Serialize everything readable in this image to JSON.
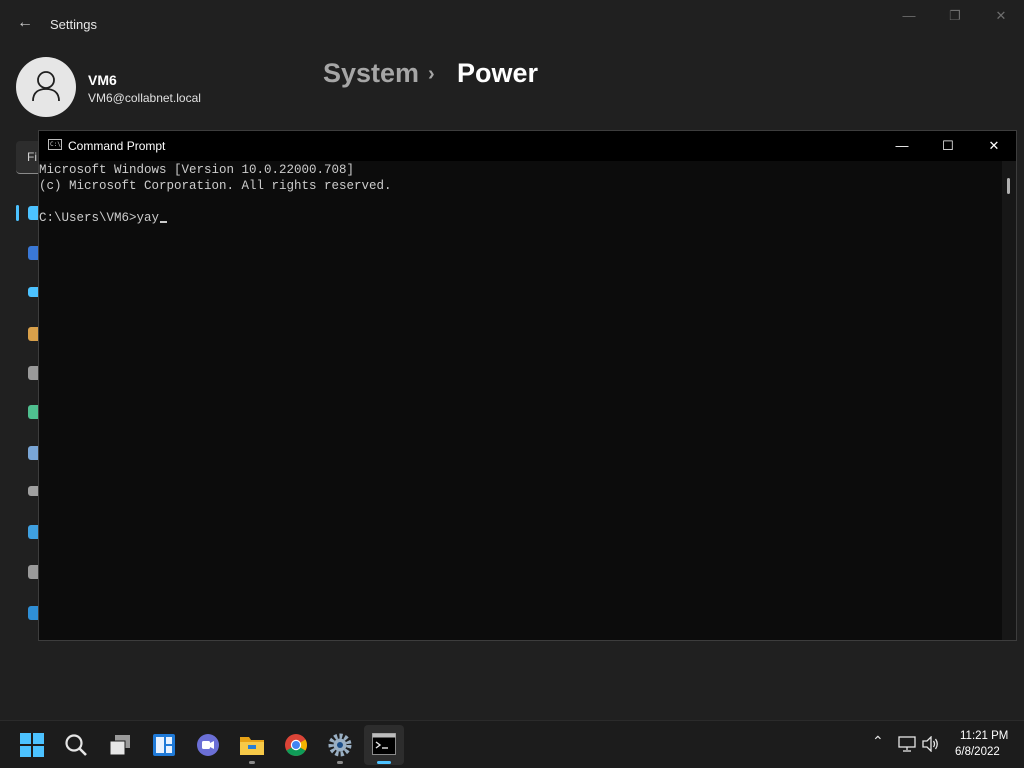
{
  "settings": {
    "window_title": "Settings",
    "back_icon": "back-arrow-icon",
    "user": {
      "name": "VM6",
      "email": "VM6@collabnet.local"
    },
    "breadcrumb": {
      "parent": "System",
      "separator": "›",
      "current": "Power"
    },
    "search": {
      "placeholder": "Fi"
    },
    "nav_icons": [
      "system-icon",
      "bluetooth-icon",
      "network-icon",
      "personalization-icon",
      "apps-icon",
      "accounts-icon",
      "time-language-icon",
      "gaming-icon",
      "accessibility-icon",
      "privacy-icon",
      "windows-update-icon"
    ],
    "accent": "#4cc2ff"
  },
  "cmd": {
    "title": "Command Prompt",
    "icon_text": "C:\\",
    "lines": [
      "Microsoft Windows [Version 10.0.22000.708]",
      "(c) Microsoft Corporation. All rights reserved.",
      "",
      "C:\\Users\\VM6>yay"
    ],
    "background": "#0c0c0c",
    "text_color": "#cccccc"
  },
  "taskbar": {
    "apps": [
      "start-icon",
      "search-icon",
      "task-view-icon",
      "widgets-icon",
      "teams-chat-icon",
      "file-explorer-icon",
      "chrome-icon",
      "settings-icon",
      "command-prompt-icon"
    ],
    "time": "11:21 PM",
    "date": "6/8/2022"
  }
}
